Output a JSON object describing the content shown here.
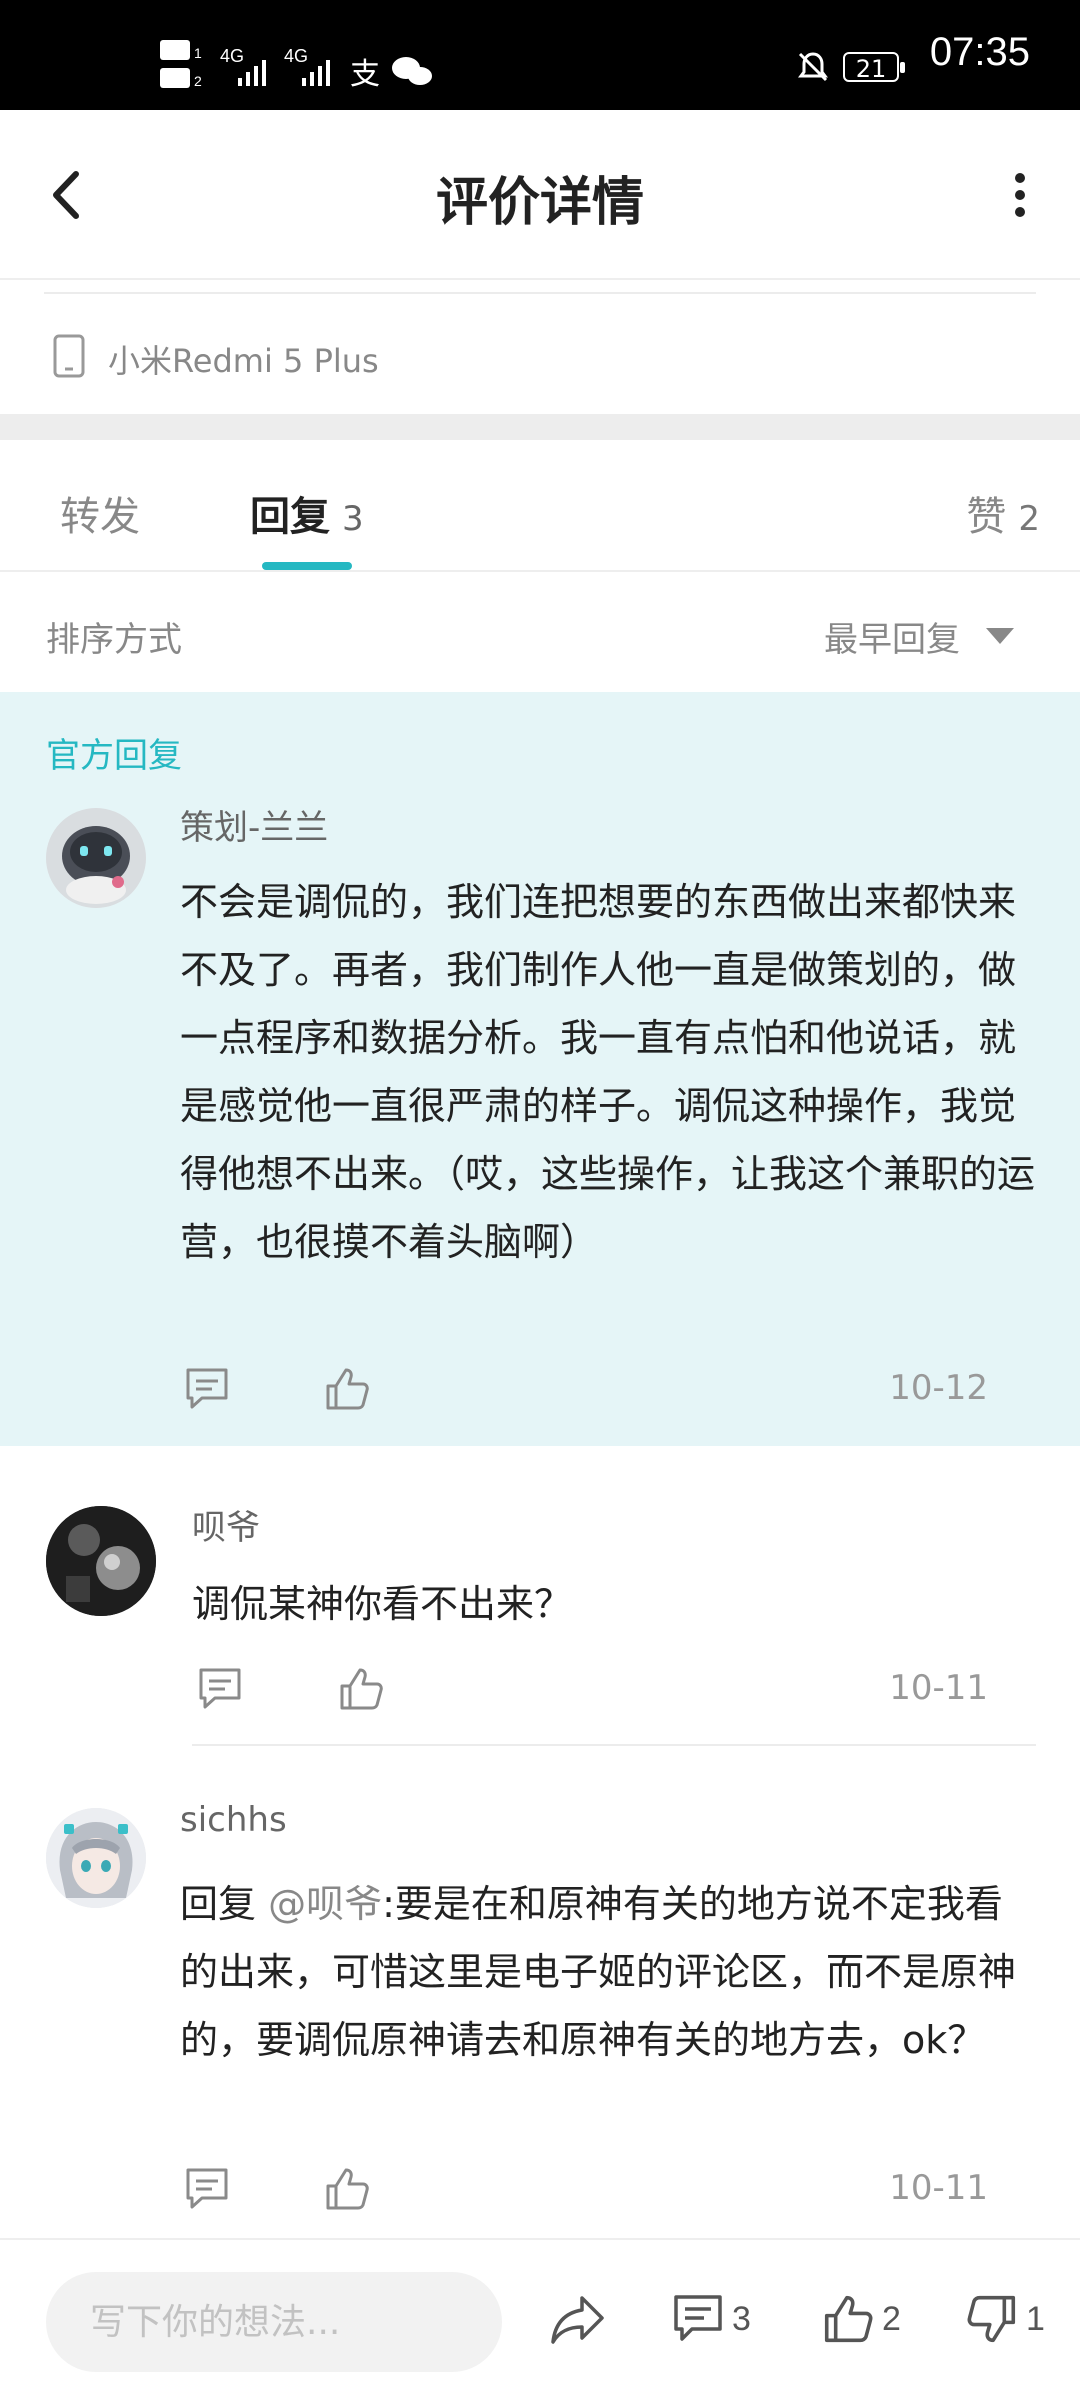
{
  "status_bar": {
    "left_indicators": "HD 4G 4G 支",
    "battery": "21",
    "time": "07:35"
  },
  "header": {
    "title": "评价详情",
    "back_icon": "chevron-left-icon",
    "more_icon": "vertical-dots-icon"
  },
  "device": {
    "icon": "phone-icon",
    "label": "小米Redmi 5 Plus"
  },
  "tabs": [
    {
      "label": "转发",
      "count": ""
    },
    {
      "label": "回复",
      "count": "3"
    },
    {
      "label": "赞",
      "count": "2"
    }
  ],
  "accent_color": "#25b8c2",
  "sort": {
    "label": "排序方式",
    "value": "最早回复"
  },
  "official": {
    "label": "官方回复",
    "background": "#e5f5f7"
  },
  "comments": [
    {
      "username": "策划-兰兰",
      "text": "不会是调侃的，我们连把想要的东西做出来都快来不及了。再者，我们制作人他一直是做策划的，做一点程序和数据分析。我一直有点怕和他说话，就是感觉他一直很严肃的样子。调侃这种操作，我觉得他想不出来。（哎，这些操作，让我这个兼职的运营，也很摸不着头脑啊）",
      "date": "10-12"
    },
    {
      "username": "呗爷",
      "text": "调侃某神你看不出来？",
      "date": "10-11"
    },
    {
      "username": "sichhs",
      "reply_prefix": "回复 ",
      "mention": "@呗爷",
      "text": ":要是在和原神有关的地方说不定我看的出来，可惜这里是电子姬的评论区，而不是原神的，要调侃原神请去和原神有关的地方去，ok？",
      "date": "10-11"
    }
  ],
  "bottom_bar": {
    "input_placeholder": "写下你的想法...",
    "share_icon": "share-icon",
    "comment_count": "3",
    "like_count": "2",
    "dislike_count": "1"
  }
}
